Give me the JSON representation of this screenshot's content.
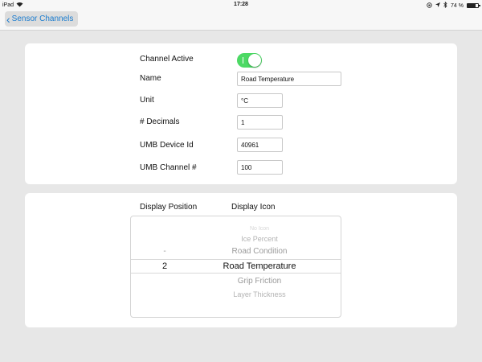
{
  "status_bar": {
    "device": "iPad",
    "time": "17:28",
    "battery_text": "74 %",
    "battery_level_percent": 74
  },
  "nav": {
    "back_label": "Sensor Channels"
  },
  "form": {
    "channel_active_label": "Channel Active",
    "channel_active_on": true,
    "channel_active_mark": "I",
    "name_label": "Name",
    "name_value": "Road Temperature",
    "unit_label": "Unit",
    "unit_value": "°C",
    "decimals_label": "# Decimals",
    "decimals_value": "1",
    "umb_device_label": "UMB Device Id",
    "umb_device_value": "40961",
    "umb_channel_label": "UMB Channel #",
    "umb_channel_value": "100"
  },
  "display": {
    "position_header": "Display Position",
    "icon_header": "Display Icon",
    "picker_rows": [
      {
        "position": "",
        "icon": "No Icon"
      },
      {
        "position": "",
        "icon": "Ice Percent"
      },
      {
        "position": "-",
        "icon": "Road Condition"
      },
      {
        "position": "2",
        "icon": "Road Temperature"
      },
      {
        "position": "",
        "icon": "Grip Friction"
      },
      {
        "position": "",
        "icon": "Layer Thickness"
      }
    ],
    "selected_index": 3
  },
  "colors": {
    "accent": "#1a7ccf",
    "toggle_on": "#4cd964",
    "background": "#e7e7e7"
  }
}
